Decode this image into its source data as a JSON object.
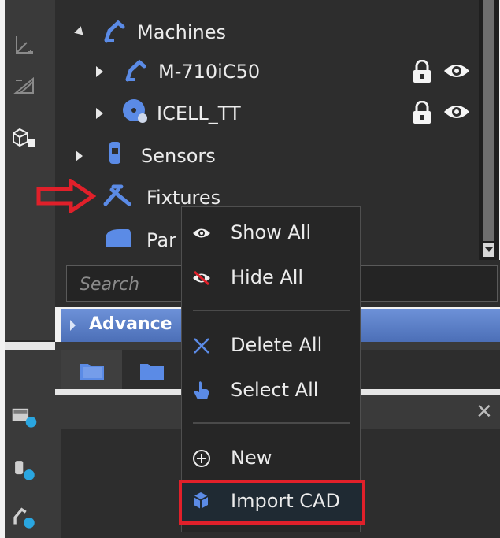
{
  "tree": {
    "items": [
      {
        "label": "Machines"
      },
      {
        "label": "M-710iC50"
      },
      {
        "label": "ICELL_TT"
      },
      {
        "label": "Sensors"
      },
      {
        "label": "Fixtures"
      },
      {
        "label": "Par"
      }
    ]
  },
  "search": {
    "placeholder": "Search"
  },
  "advanced": {
    "label": "Advance"
  },
  "context_menu": {
    "items": [
      {
        "label": "Show All"
      },
      {
        "label": "Hide All"
      },
      {
        "label": "Delete All"
      },
      {
        "label": "Select All"
      },
      {
        "label": "New"
      },
      {
        "label": "Import CAD"
      }
    ]
  },
  "colors": {
    "accent_blue": "#5b8be6",
    "annotation_red": "#e0202a",
    "panel_dark": "#2d2d2d"
  },
  "icons": [
    "robot-arm-icon",
    "turntable-icon",
    "sensor-icon",
    "fixture-icon",
    "part-icon",
    "lock-icon",
    "eye-icon",
    "eye-off-icon",
    "close-x-icon",
    "hand-pointer-icon",
    "plus-circle-icon",
    "import-cad-icon",
    "folder-icon"
  ]
}
